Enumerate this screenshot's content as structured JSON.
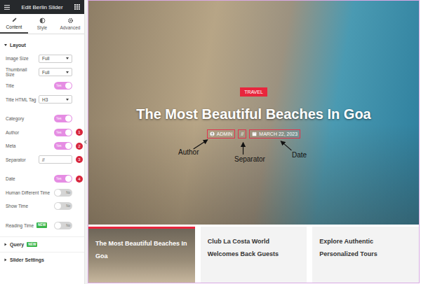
{
  "panel": {
    "title": "Edit Berlin Slider",
    "tabs": [
      {
        "label": "Content",
        "selected": true
      },
      {
        "label": "Style",
        "selected": false
      },
      {
        "label": "Advanced",
        "selected": false
      }
    ],
    "section": {
      "label": "Layout",
      "expanded": true
    },
    "controls": [
      {
        "kind": "select",
        "label": "Image Size",
        "value": "Full",
        "badge": ""
      },
      {
        "kind": "select",
        "label": "Thumbnail Size",
        "value": "Full",
        "badge": ""
      },
      {
        "kind": "toggle",
        "label": "Title",
        "on": true,
        "value": "Yes",
        "badge": ""
      },
      {
        "kind": "select",
        "label": "Title HTML Tag",
        "value": "H3",
        "badge": ""
      },
      {
        "kind": "toggle",
        "label": "Category",
        "on": true,
        "value": "Yes",
        "badge": ""
      },
      {
        "kind": "toggle",
        "label": "Author",
        "on": true,
        "value": "Yes",
        "badge": "1"
      },
      {
        "kind": "toggle",
        "label": "Meta",
        "on": true,
        "value": "Yes",
        "badge": "2"
      },
      {
        "kind": "text",
        "label": "Separator",
        "value": "//",
        "badge": "3"
      },
      {
        "kind": "toggle",
        "label": "Date",
        "on": true,
        "value": "Yes",
        "badge": "4"
      },
      {
        "kind": "toggle",
        "label": "Human Different Time",
        "on": false,
        "value": "No",
        "badge": ""
      },
      {
        "kind": "toggle",
        "label": "Show Time",
        "on": false,
        "value": "No",
        "badge": ""
      },
      {
        "kind": "toggle",
        "label": "Reading Time",
        "on": false,
        "value": "No",
        "badge": "",
        "tag": "NEW"
      }
    ],
    "collapsed_sections": [
      {
        "label": "Query",
        "tag": "NEW",
        "expanded": false
      },
      {
        "label": "Slider Settings",
        "tag": "",
        "expanded": false
      }
    ]
  },
  "preview": {
    "category": "TRAVEL",
    "title": "The Most Beautiful Beaches In Goa",
    "meta": {
      "author": "ADMIN",
      "separator": "//",
      "date": "MARCH 22, 2023"
    },
    "annotations": {
      "author": "Author",
      "separator": "Separator",
      "date": "Date"
    },
    "cards": [
      {
        "title": "The Most Beautiful Beaches In Goa",
        "selected": true
      },
      {
        "title": "Club La Costa World Welcomes Back Guests",
        "selected": false
      },
      {
        "title": "Explore Authentic Personalized Tours",
        "selected": false
      }
    ]
  }
}
